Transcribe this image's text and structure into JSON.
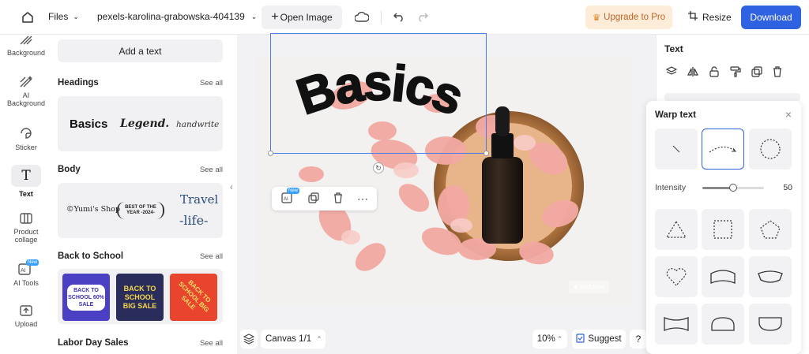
{
  "topbar": {
    "files_label": "Files",
    "filename": "pexels-karolina-grabowska-404139",
    "open_image_label": "Open Image",
    "upgrade_label": "Upgrade to Pro",
    "resize_label": "Resize",
    "download_label": "Download",
    "accent_color": "#2f62e0",
    "upgrade_bg": "#fdecd8"
  },
  "leftnav": {
    "items": [
      {
        "label": "Background",
        "icon": "background-icon"
      },
      {
        "label": "AI Background",
        "icon": "ai-background-icon"
      },
      {
        "label": "Sticker",
        "icon": "sticker-icon"
      },
      {
        "label": "Text",
        "icon": "text-icon"
      },
      {
        "label": "Product collage",
        "icon": "product-collage-icon"
      },
      {
        "label": "AI Tools",
        "icon": "ai-tools-icon",
        "badge": "New"
      },
      {
        "label": "Upload",
        "icon": "upload-icon"
      }
    ]
  },
  "panel": {
    "add_text": "Add a text",
    "see_all": "See all",
    "sections": [
      {
        "title": "Headings",
        "samples": [
          "Basics",
          "Legend.",
          "handwrite"
        ]
      },
      {
        "title": "Body",
        "samples": [
          "©Yumi's Shop",
          "BEST OF THE YEAR -2024-",
          "Travel",
          "-life-"
        ]
      },
      {
        "title": "Back to School",
        "samples": [
          "BACK TO SCHOOL 60% SALE",
          "BACK TO SCHOOL BIG SALE",
          "BACK TO SCHOOL BIG SALE"
        ]
      },
      {
        "title": "Labor Day Sales"
      }
    ]
  },
  "canvas": {
    "headline": "Basics",
    "watermark": "insMind",
    "ai_badge": "New",
    "canvas_label": "Canvas 1/1",
    "zoom": "10%",
    "suggest_label": "Suggest",
    "help": "?"
  },
  "rightpanel": {
    "title": "Text"
  },
  "warp": {
    "title": "Warp text",
    "intensity_label": "Intensity",
    "intensity_value": "50",
    "intensity_fraction": 0.5
  }
}
